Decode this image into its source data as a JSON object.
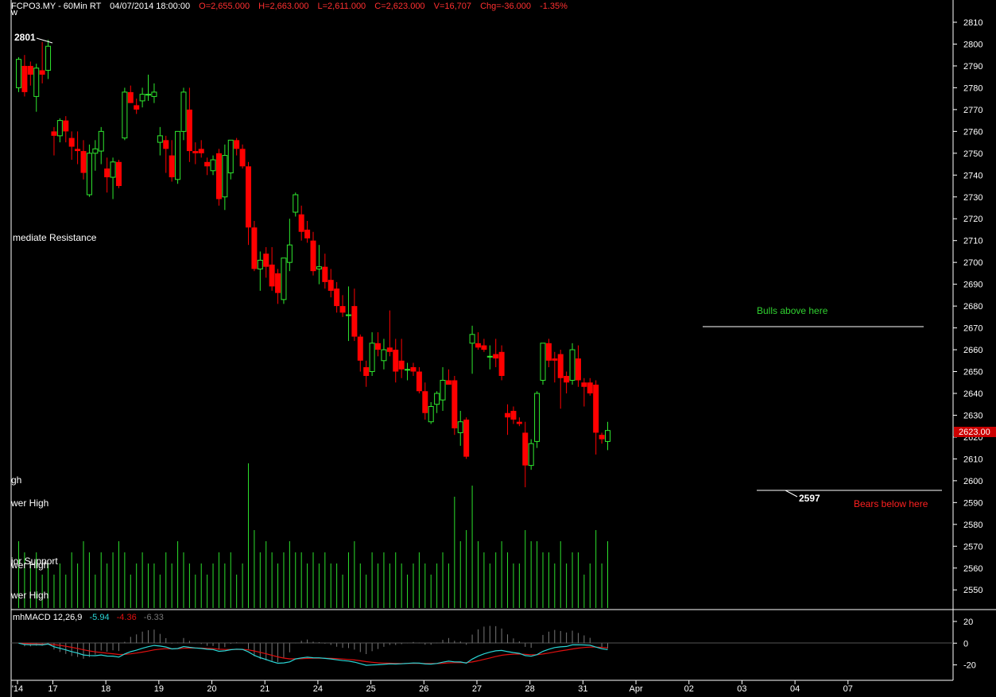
{
  "colors": {
    "background": "#000000",
    "up": "#2fe82f",
    "down": "#ff0000",
    "volume": "#2ce02c",
    "annot_green": "#30d030",
    "annot_red": "#ff2020",
    "macd_line": "#2ad6d6",
    "macd_signal": "#e01010",
    "macd_hist": "#777777",
    "header_green": "#3ad13a",
    "header_red": "#ff3030",
    "axis": "#ffffff",
    "price_badge": "#cc0000"
  },
  "header": {
    "symbol": "FCPO3.MY - 60Min RT",
    "datetime": "04/07/2014  18:00:00",
    "open": "O=2,655.000",
    "high": "H=2,663.000",
    "low": "L=2,611.000",
    "close": "C=2,623.000",
    "volume": "V=16,707",
    "change": "Chg=-36.000",
    "change_pct": "-1.35%"
  },
  "left_labels": [
    "w",
    "mediate Resistance",
    "gh",
    "wer High",
    "jor Support",
    "wer High",
    "wer High"
  ],
  "annotations": {
    "high_label": "2801",
    "low_label": "2597",
    "bulls": "Bulls above here",
    "bears": "Bears below here"
  },
  "macd_legend": {
    "name": "mhMACD 12,26,9",
    "v1": "-5.94",
    "v2": "-4.36",
    "v3": "-6.33"
  },
  "current_price_badge": "2623.00",
  "chart_data": {
    "type": "candlestick",
    "price_axis": {
      "ylim": [
        2543,
        2822
      ],
      "ticks": [
        2810,
        2800,
        2790,
        2780,
        2770,
        2760,
        2750,
        2740,
        2730,
        2720,
        2710,
        2700,
        2690,
        2680,
        2670,
        2660,
        2650,
        2640,
        2630,
        2620,
        2610,
        2600,
        2590,
        2580,
        2570,
        2560,
        2550
      ]
    },
    "macd_axis": {
      "ylim": [
        -32,
        28
      ],
      "ticks": [
        20,
        0,
        -20
      ],
      "tick_labels": [
        "20",
        "0",
        "-20"
      ]
    },
    "x_axis_labels": [
      {
        "bar": 0,
        "label": "'14"
      },
      {
        "bar": 6,
        "label": "17"
      },
      {
        "bar": 15,
        "label": "18"
      },
      {
        "bar": 24,
        "label": "19"
      },
      {
        "bar": 33,
        "label": "20"
      },
      {
        "bar": 42,
        "label": "21"
      },
      {
        "bar": 51,
        "label": "24"
      },
      {
        "bar": 60,
        "label": "25"
      },
      {
        "bar": 69,
        "label": "26"
      },
      {
        "bar": 78,
        "label": "27"
      },
      {
        "bar": 87,
        "label": "28"
      },
      {
        "bar": 96,
        "label": "31"
      },
      {
        "bar": 105,
        "label": "Apr"
      },
      {
        "bar": 114,
        "label": "02"
      },
      {
        "bar": 123,
        "label": "03"
      },
      {
        "bar": 132,
        "label": "04"
      },
      {
        "bar": 141,
        "label": "07"
      }
    ],
    "candles": [
      {
        "o": 2780,
        "h": 2794,
        "l": 2778,
        "c": 2793,
        "v": 6
      },
      {
        "o": 2790,
        "h": 2795,
        "l": 2776,
        "c": 2778,
        "v": 5
      },
      {
        "o": 2790,
        "h": 2792,
        "l": 2781,
        "c": 2786,
        "v": 4
      },
      {
        "o": 2776,
        "h": 2791,
        "l": 2769,
        "c": 2789,
        "v": 5
      },
      {
        "o": 2788,
        "h": 2801,
        "l": 2782,
        "c": 2786,
        "v": 3
      },
      {
        "o": 2788,
        "h": 2802,
        "l": 2784,
        "c": 2799,
        "v": 4
      },
      {
        "o": 2760,
        "h": 2762,
        "l": 2749,
        "c": 2758,
        "v": 3
      },
      {
        "o": 2758,
        "h": 2766,
        "l": 2755,
        "c": 2765,
        "v": 4
      },
      {
        "o": 2765,
        "h": 2767,
        "l": 2755,
        "c": 2760,
        "v": 3
      },
      {
        "o": 2757,
        "h": 2760,
        "l": 2747,
        "c": 2753,
        "v": 5
      },
      {
        "o": 2752,
        "h": 2760,
        "l": 2745,
        "c": 2751,
        "v": 4
      },
      {
        "o": 2751,
        "h": 2756,
        "l": 2738,
        "c": 2741,
        "v": 6
      },
      {
        "o": 2731,
        "h": 2754,
        "l": 2730,
        "c": 2750,
        "v": 5
      },
      {
        "o": 2750,
        "h": 2756,
        "l": 2742,
        "c": 2752,
        "v": 3
      },
      {
        "o": 2751,
        "h": 2762,
        "l": 2745,
        "c": 2760,
        "v": 5
      },
      {
        "o": 2743,
        "h": 2748,
        "l": 2732,
        "c": 2739,
        "v": 4
      },
      {
        "o": 2739,
        "h": 2748,
        "l": 2729,
        "c": 2746,
        "v": 5
      },
      {
        "o": 2746,
        "h": 2747,
        "l": 2734,
        "c": 2735,
        "v": 6
      },
      {
        "o": 2757,
        "h": 2780,
        "l": 2756,
        "c": 2778,
        "v": 5
      },
      {
        "o": 2778,
        "h": 2781,
        "l": 2773,
        "c": 2773,
        "v": 3
      },
      {
        "o": 2772,
        "h": 2775,
        "l": 2768,
        "c": 2770,
        "v": 4
      },
      {
        "o": 2774,
        "h": 2780,
        "l": 2771,
        "c": 2777,
        "v": 5
      },
      {
        "o": 2777,
        "h": 2786,
        "l": 2774,
        "c": 2777,
        "v": 4
      },
      {
        "o": 2776,
        "h": 2782,
        "l": 2773,
        "c": 2778,
        "v": 4
      },
      {
        "o": 2755,
        "h": 2762,
        "l": 2749,
        "c": 2758,
        "v": 3
      },
      {
        "o": 2756,
        "h": 2758,
        "l": 2741,
        "c": 2752,
        "v": 5
      },
      {
        "o": 2749,
        "h": 2756,
        "l": 2737,
        "c": 2739,
        "v": 4
      },
      {
        "o": 2738,
        "h": 2760,
        "l": 2736,
        "c": 2760,
        "v": 6
      },
      {
        "o": 2760,
        "h": 2780,
        "l": 2756,
        "c": 2778,
        "v": 5
      },
      {
        "o": 2770,
        "h": 2780,
        "l": 2746,
        "c": 2751,
        "v": 4
      },
      {
        "o": 2751,
        "h": 2755,
        "l": 2745,
        "c": 2750,
        "v": 3
      },
      {
        "o": 2752,
        "h": 2756,
        "l": 2748,
        "c": 2750,
        "v": 4
      },
      {
        "o": 2746,
        "h": 2748,
        "l": 2740,
        "c": 2744,
        "v": 3
      },
      {
        "o": 2742,
        "h": 2749,
        "l": 2740,
        "c": 2747,
        "v": 4
      },
      {
        "o": 2750,
        "h": 2752,
        "l": 2726,
        "c": 2729,
        "v": 5
      },
      {
        "o": 2730,
        "h": 2754,
        "l": 2724,
        "c": 2749,
        "v": 4
      },
      {
        "o": 2741,
        "h": 2756,
        "l": 2738,
        "c": 2756,
        "v": 5
      },
      {
        "o": 2756,
        "h": 2757,
        "l": 2749,
        "c": 2752,
        "v": 3
      },
      {
        "o": 2752,
        "h": 2754,
        "l": 2743,
        "c": 2744,
        "v": 4
      },
      {
        "o": 2744,
        "h": 2746,
        "l": 2708,
        "c": 2716,
        "v": 13
      },
      {
        "o": 2716,
        "h": 2719,
        "l": 2696,
        "c": 2697,
        "v": 7
      },
      {
        "o": 2697,
        "h": 2705,
        "l": 2687,
        "c": 2701,
        "v": 5
      },
      {
        "o": 2704,
        "h": 2707,
        "l": 2693,
        "c": 2698,
        "v": 6
      },
      {
        "o": 2699,
        "h": 2707,
        "l": 2687,
        "c": 2689,
        "v": 5
      },
      {
        "o": 2695,
        "h": 2697,
        "l": 2681,
        "c": 2686,
        "v": 4
      },
      {
        "o": 2683,
        "h": 2702,
        "l": 2681,
        "c": 2702,
        "v": 5
      },
      {
        "o": 2700,
        "h": 2720,
        "l": 2696,
        "c": 2708,
        "v": 6
      },
      {
        "o": 2723,
        "h": 2732,
        "l": 2721,
        "c": 2731,
        "v": 5
      },
      {
        "o": 2722,
        "h": 2726,
        "l": 2710,
        "c": 2714,
        "v": 5
      },
      {
        "o": 2715,
        "h": 2719,
        "l": 2709,
        "c": 2711,
        "v": 4
      },
      {
        "o": 2710,
        "h": 2714,
        "l": 2694,
        "c": 2696,
        "v": 5
      },
      {
        "o": 2697,
        "h": 2708,
        "l": 2690,
        "c": 2698,
        "v": 4
      },
      {
        "o": 2698,
        "h": 2704,
        "l": 2688,
        "c": 2691,
        "v": 5
      },
      {
        "o": 2692,
        "h": 2697,
        "l": 2684,
        "c": 2687,
        "v": 4
      },
      {
        "o": 2688,
        "h": 2691,
        "l": 2677,
        "c": 2680,
        "v": 4
      },
      {
        "o": 2680,
        "h": 2685,
        "l": 2675,
        "c": 2677,
        "v": 3
      },
      {
        "o": 2676,
        "h": 2689,
        "l": 2664,
        "c": 2676,
        "v": 5
      },
      {
        "o": 2680,
        "h": 2688,
        "l": 2664,
        "c": 2666,
        "v": 6
      },
      {
        "o": 2666,
        "h": 2667,
        "l": 2650,
        "c": 2655,
        "v": 4
      },
      {
        "o": 2652,
        "h": 2655,
        "l": 2643,
        "c": 2648,
        "v": 3
      },
      {
        "o": 2650,
        "h": 2668,
        "l": 2648,
        "c": 2663,
        "v": 5
      },
      {
        "o": 2663,
        "h": 2668,
        "l": 2657,
        "c": 2660,
        "v": 4
      },
      {
        "o": 2655,
        "h": 2665,
        "l": 2651,
        "c": 2660,
        "v": 5
      },
      {
        "o": 2661,
        "h": 2678,
        "l": 2657,
        "c": 2659,
        "v": 4
      },
      {
        "o": 2660,
        "h": 2665,
        "l": 2645,
        "c": 2650,
        "v": 5
      },
      {
        "o": 2655,
        "h": 2665,
        "l": 2647,
        "c": 2651,
        "v": 4
      },
      {
        "o": 2651,
        "h": 2654,
        "l": 2646,
        "c": 2651,
        "v": 3
      },
      {
        "o": 2652,
        "h": 2654,
        "l": 2648,
        "c": 2650,
        "v": 4
      },
      {
        "o": 2650,
        "h": 2652,
        "l": 2640,
        "c": 2641,
        "v": 5
      },
      {
        "o": 2641,
        "h": 2645,
        "l": 2628,
        "c": 2631,
        "v": 4
      },
      {
        "o": 2627,
        "h": 2636,
        "l": 2626,
        "c": 2634,
        "v": 3
      },
      {
        "o": 2635,
        "h": 2641,
        "l": 2631,
        "c": 2640,
        "v": 4
      },
      {
        "o": 2637,
        "h": 2652,
        "l": 2632,
        "c": 2646,
        "v": 5
      },
      {
        "o": 2646,
        "h": 2651,
        "l": 2644,
        "c": 2644,
        "v": 4
      },
      {
        "o": 2646,
        "h": 2648,
        "l": 2621,
        "c": 2624,
        "v": 10
      },
      {
        "o": 2622,
        "h": 2632,
        "l": 2616,
        "c": 2627,
        "v": 6
      },
      {
        "o": 2628,
        "h": 2629,
        "l": 2610,
        "c": 2611,
        "v": 7
      },
      {
        "o": 2663,
        "h": 2671,
        "l": 2649,
        "c": 2667,
        "v": 11
      },
      {
        "o": 2663,
        "h": 2668,
        "l": 2660,
        "c": 2661,
        "v": 6
      },
      {
        "o": 2662,
        "h": 2665,
        "l": 2659,
        "c": 2660,
        "v": 5
      },
      {
        "o": 2657,
        "h": 2662,
        "l": 2651,
        "c": 2657,
        "v": 4
      },
      {
        "o": 2658,
        "h": 2665,
        "l": 2652,
        "c": 2656,
        "v": 5
      },
      {
        "o": 2659,
        "h": 2662,
        "l": 2646,
        "c": 2648,
        "v": 6
      },
      {
        "o": 2631,
        "h": 2635,
        "l": 2621,
        "c": 2629,
        "v": 5
      },
      {
        "o": 2632,
        "h": 2634,
        "l": 2626,
        "c": 2628,
        "v": 4
      },
      {
        "o": 2627,
        "h": 2629,
        "l": 2625,
        "c": 2626,
        "v": 4
      },
      {
        "o": 2622,
        "h": 2627,
        "l": 2597,
        "c": 2607,
        "v": 7
      },
      {
        "o": 2607,
        "h": 2619,
        "l": 2605,
        "c": 2617,
        "v": 6
      },
      {
        "o": 2618,
        "h": 2641,
        "l": 2615,
        "c": 2640,
        "v": 6
      },
      {
        "o": 2646,
        "h": 2662,
        "l": 2644,
        "c": 2663,
        "v": 5
      },
      {
        "o": 2663,
        "h": 2665,
        "l": 2652,
        "c": 2655,
        "v": 5
      },
      {
        "o": 2656,
        "h": 2659,
        "l": 2645,
        "c": 2655,
        "v": 4
      },
      {
        "o": 2658,
        "h": 2660,
        "l": 2633,
        "c": 2647,
        "v": 6
      },
      {
        "o": 2648,
        "h": 2650,
        "l": 2640,
        "c": 2645,
        "v": 4
      },
      {
        "o": 2646,
        "h": 2663,
        "l": 2644,
        "c": 2660,
        "v": 5
      },
      {
        "o": 2656,
        "h": 2662,
        "l": 2643,
        "c": 2646,
        "v": 5
      },
      {
        "o": 2645,
        "h": 2647,
        "l": 2634,
        "c": 2643,
        "v": 3
      },
      {
        "o": 2645,
        "h": 2647,
        "l": 2639,
        "c": 2640,
        "v": 4
      },
      {
        "o": 2644,
        "h": 2646,
        "l": 2612,
        "c": 2622,
        "v": 7
      },
      {
        "o": 2621,
        "h": 2622,
        "l": 2617,
        "c": 2619,
        "v": 4
      },
      {
        "o": 2618,
        "h": 2627,
        "l": 2614,
        "c": 2623,
        "v": 6
      }
    ]
  }
}
